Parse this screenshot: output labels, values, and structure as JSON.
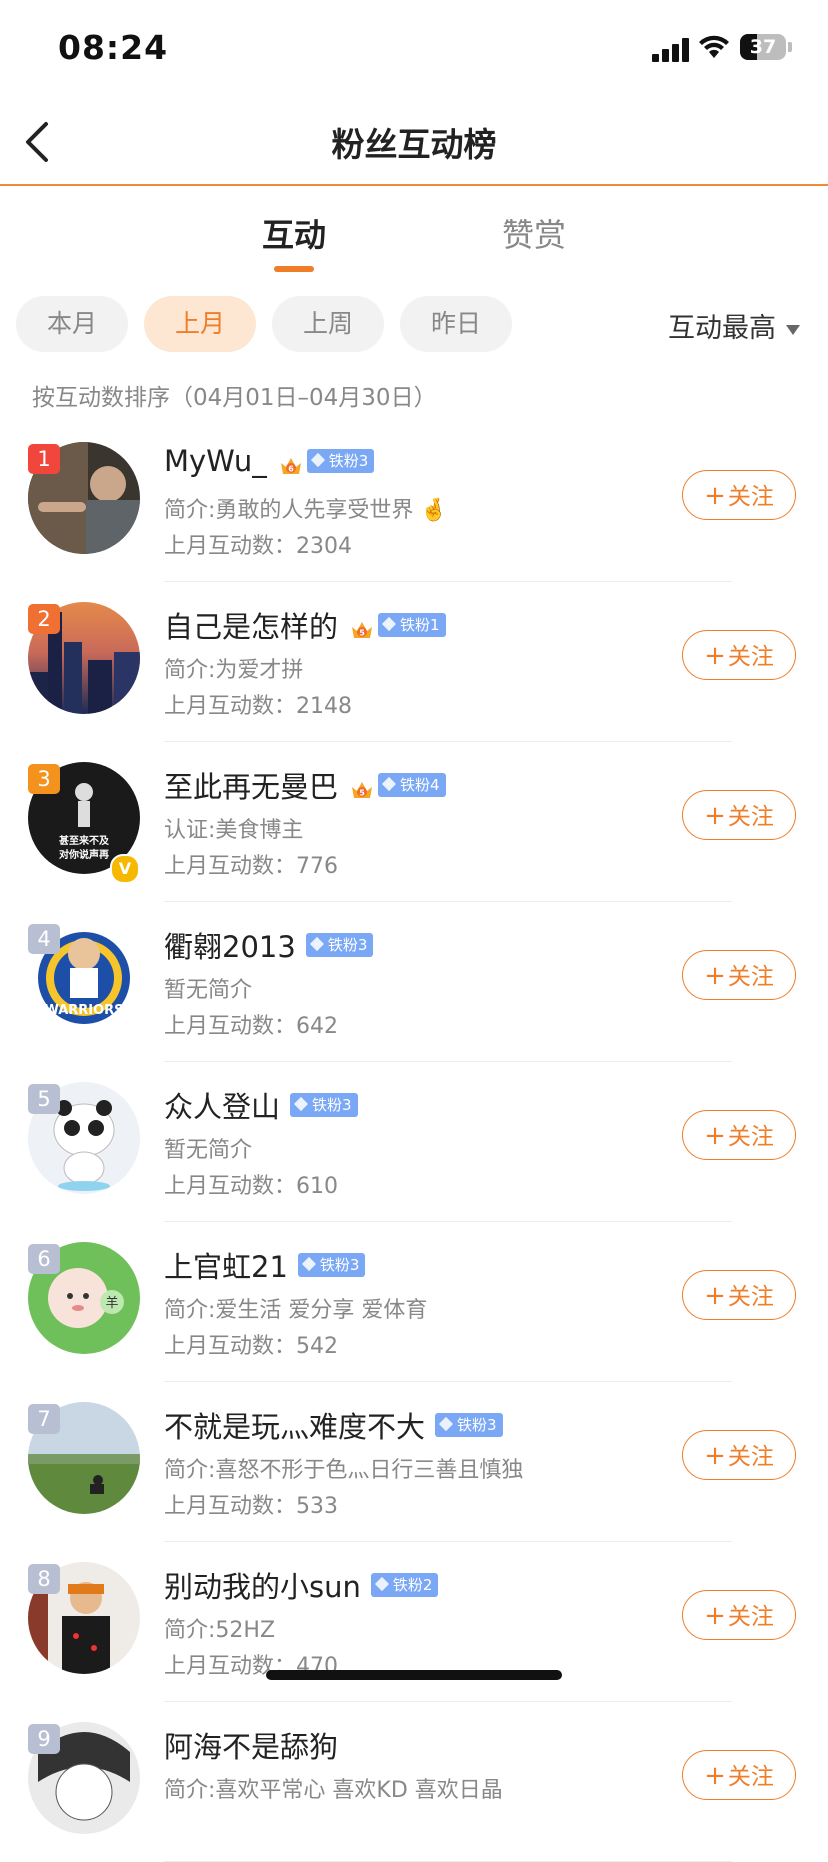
{
  "status_bar": {
    "time": "08:24",
    "battery": "37",
    "battery_level": 0.37
  },
  "nav": {
    "title": "粉丝互动榜"
  },
  "tabs": [
    {
      "label": "互动",
      "active": true
    },
    {
      "label": "赞赏",
      "active": false
    }
  ],
  "filters": {
    "chips": [
      "本月",
      "上月",
      "上周",
      "昨日"
    ],
    "selected": "上月",
    "sort_label": "互动最高"
  },
  "range_note": "按互动数排序（04月01日–04月30日）",
  "follow_label": "关注",
  "users": [
    {
      "rank": "1",
      "name": "MyWu_",
      "tag": "铁粉3",
      "bio": "简介:勇敢的人先享受世界 🤞",
      "count": "上月互动数：2304",
      "badge_level": "6",
      "rank_color": "#f0463c",
      "verified": false
    },
    {
      "rank": "2",
      "name": "自己是怎样的",
      "tag": "铁粉1",
      "bio": "简介:为爱才拼",
      "count": "上月互动数：2148",
      "badge_level": "5",
      "rank_color": "#f06f32",
      "verified": false
    },
    {
      "rank": "3",
      "name": "至此再无曼巴",
      "tag": "铁粉4",
      "bio": "认证:美食博主",
      "count": "上月互动数：776",
      "badge_level": "5",
      "rank_color": "#f4921e",
      "verified": true,
      "avatar_text": "甚至来不及\n对你说声再见"
    },
    {
      "rank": "4",
      "name": "衢翱2013",
      "tag": "铁粉3",
      "bio": "暂无简介",
      "count": "上月互动数：642",
      "badge_level": "",
      "rank_color": "#b9bfd3",
      "verified": false,
      "avatar_text": "WARRIORS"
    },
    {
      "rank": "5",
      "name": "众人登山",
      "tag": "铁粉3",
      "bio": "暂无简介",
      "count": "上月互动数：610",
      "badge_level": "",
      "rank_color": "#b9bfd3",
      "verified": false
    },
    {
      "rank": "6",
      "name": "上官虹21",
      "tag": "铁粉3",
      "bio": "简介:爱生活 爱分享 爱体育",
      "count": "上月互动数：542",
      "badge_level": "",
      "rank_color": "#b9bfd3",
      "verified": false,
      "avatar_text": "羊"
    },
    {
      "rank": "7",
      "name": "不就是玩灬难度不大",
      "tag": "铁粉3",
      "bio": "简介:喜怒不形于色灬日行三善且慎独",
      "count": "上月互动数：533",
      "badge_level": "",
      "rank_color": "#b9bfd3",
      "verified": false
    },
    {
      "rank": "8",
      "name": "别动我的小sun",
      "tag": "铁粉2",
      "bio": "简介:52HZ",
      "count": "上月互动数：470",
      "badge_level": "",
      "rank_color": "#b9bfd3",
      "verified": false
    },
    {
      "rank": "9",
      "name": "阿海不是舔狗",
      "tag": "",
      "bio": "简介:喜欢平常心 喜欢KD 喜欢日晶",
      "count": "",
      "badge_level": "",
      "rank_color": "#b9bfd3",
      "verified": false
    }
  ],
  "icons": {
    "back": "chevron-left-icon",
    "crown": "crown-icon",
    "fan_tag": "diamond-icon",
    "follow": "plus-icon",
    "sort": "caret-down-icon"
  },
  "colors": {
    "accent": "#f07d28",
    "chip_selected_bg": "#fde7d3",
    "fan_tag": "#7aa8f5"
  }
}
